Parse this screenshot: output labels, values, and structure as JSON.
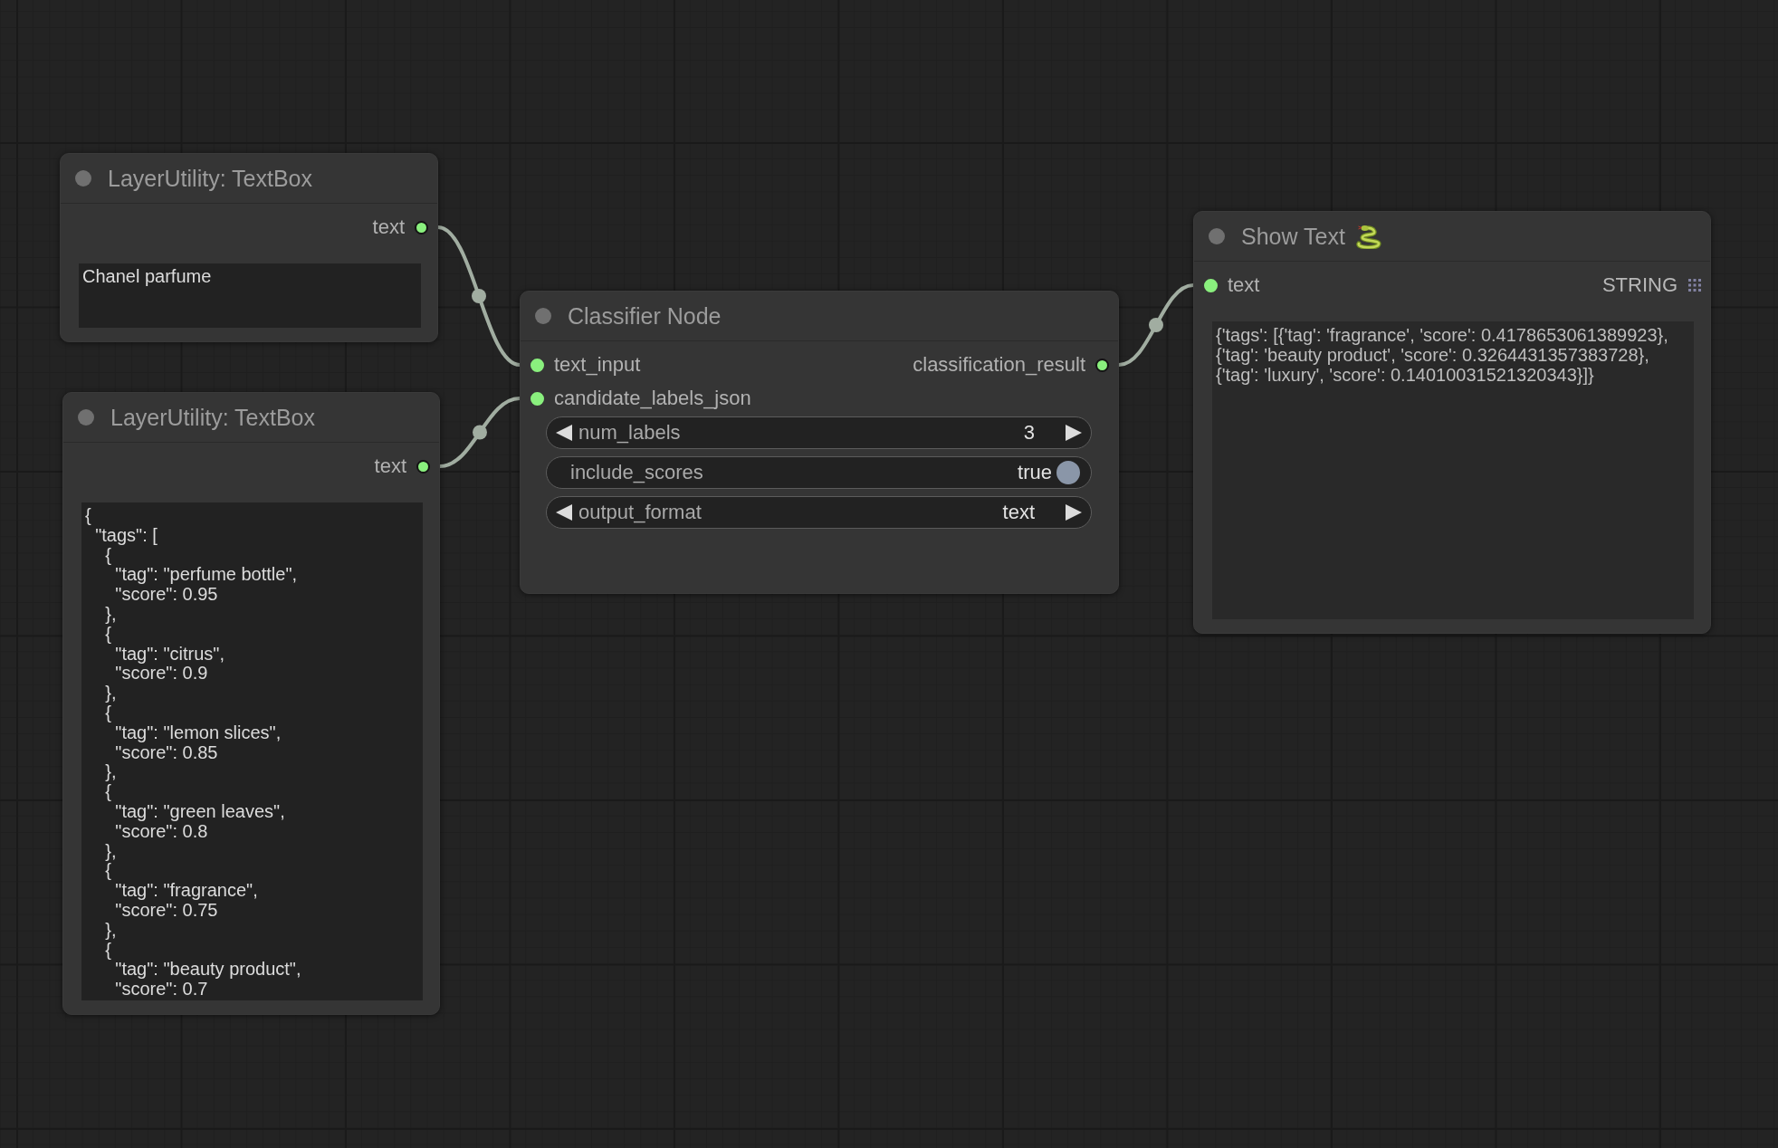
{
  "nodes": [
    {
      "kind": "textbox",
      "title": "LayerUtility: TextBox",
      "outputs": [
        {
          "label": "text",
          "linked": true
        }
      ],
      "text": "Chanel parfume"
    },
    {
      "kind": "textbox",
      "title": "LayerUtility: TextBox",
      "outputs": [
        {
          "label": "text",
          "linked": true
        }
      ],
      "text": "{\n  \"tags\": [\n    {\n      \"tag\": \"perfume bottle\",\n      \"score\": 0.95\n    },\n    {\n      \"tag\": \"citrus\",\n      \"score\": 0.9\n    },\n    {\n      \"tag\": \"lemon slices\",\n      \"score\": 0.85\n    },\n    {\n      \"tag\": \"green leaves\",\n      \"score\": 0.8\n    },\n    {\n      \"tag\": \"fragrance\",\n      \"score\": 0.75\n    },\n    {\n      \"tag\": \"beauty product\",\n      \"score\": 0.7"
    },
    {
      "kind": "classifier",
      "title": "Classifier Node",
      "inputs": [
        {
          "label": "text_input",
          "linked": true
        },
        {
          "label": "candidate_labels_json",
          "linked": true
        }
      ],
      "outputs": [
        {
          "label": "classification_result",
          "linked": true
        }
      ],
      "widgets": [
        {
          "kind": "number",
          "label": "num_labels",
          "value": "3"
        },
        {
          "kind": "toggle",
          "label": "include_scores",
          "value": "true",
          "on": true
        },
        {
          "kind": "combo",
          "label": "output_format",
          "value": "text"
        }
      ]
    },
    {
      "kind": "show_text",
      "title": "Show Text",
      "inputs": [
        {
          "label": "text",
          "linked": true,
          "type": "STRING"
        }
      ],
      "text": "{'tags': [{'tag': 'fragrance', 'score': 0.4178653061389923}, {'tag': 'beauty product', 'score': 0.3264431357383728}, {'tag': 'luxury', 'score': 0.14010031521320343}]}"
    }
  ]
}
